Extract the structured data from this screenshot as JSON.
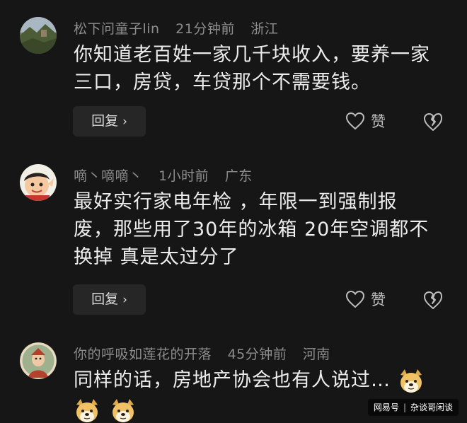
{
  "comments": [
    {
      "username": "松下问童子lin",
      "time": "21分钟前",
      "location": "浙江",
      "lines": [
        "你知道老百姓一家几千块收入，要养一家",
        "三口，房贷，车贷那个不需要钱。"
      ],
      "reply_label": "回复",
      "like_label": "赞",
      "avatar": "landscape-avatar"
    },
    {
      "username": "嘀丶嘀嘀丶",
      "time": "1小时前",
      "location": "广东",
      "lines": [
        "最好实行家电年检 ，年限一到强制报",
        "废，那些用了30年的冰箱 20年空调都不",
        "换掉 真是太过分了"
      ],
      "reply_label": "回复",
      "like_label": "赞",
      "avatar": "cartoon-avatar"
    },
    {
      "username": "你的呼吸如莲花的开落",
      "time": "45分钟前",
      "location": "河南",
      "lines": [
        "同样的话，房地产协会也有人说过…"
      ],
      "avatar": "portrait-avatar",
      "emojis": [
        "doge-emoji",
        "doge-emoji",
        "doge-emoji"
      ]
    }
  ],
  "watermark": {
    "brand": "网易号",
    "account": "杂谈哥闲谈"
  }
}
